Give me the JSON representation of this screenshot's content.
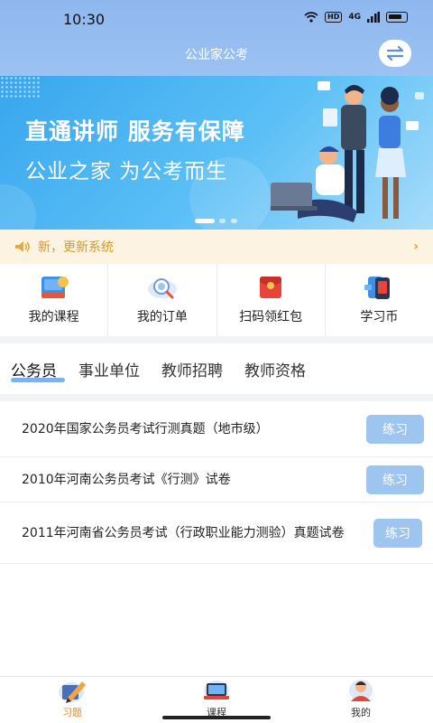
{
  "status_bar": {
    "time": "10:30",
    "hd": "HD",
    "network": "4G"
  },
  "header": {
    "title": "公业家公考"
  },
  "banner": {
    "line1": "直通讲师 服务有保障",
    "line2": "公业之家 为公考而生"
  },
  "notice": {
    "text": "新，更新系统",
    "arrow": "›"
  },
  "quick_menu": [
    {
      "label": "我的课程",
      "icon": "book-icon"
    },
    {
      "label": "我的订单",
      "icon": "order-search-icon"
    },
    {
      "label": "扫码领红包",
      "icon": "red-envelope-icon"
    },
    {
      "label": "学习币",
      "icon": "coin-phone-icon"
    }
  ],
  "category_tabs": [
    "公务员",
    "事业单位",
    "教师招聘",
    "教师资格"
  ],
  "active_tab": "公务员",
  "exam_list": [
    {
      "title": "2020年国家公务员考试行测真题（地市级）",
      "action": "练习"
    },
    {
      "title": "2010年河南公务员考试《行测》试卷",
      "action": "练习"
    },
    {
      "title": "2011年河南省公务员考试（行政职业能力测验）真题试卷",
      "action": "练习"
    }
  ],
  "bottom_nav": [
    {
      "label": "习题",
      "icon": "pencil-paper-icon",
      "active": true
    },
    {
      "label": "课程",
      "icon": "laptop-course-icon",
      "active": false
    },
    {
      "label": "我的",
      "icon": "user-avatar-icon",
      "active": false
    }
  ],
  "colors": {
    "header": "#8fb8f0",
    "banner": "#38a6ee",
    "notice_text": "#d49a28",
    "button": "#9ec5f0",
    "active_nav": "#e58a2e"
  }
}
